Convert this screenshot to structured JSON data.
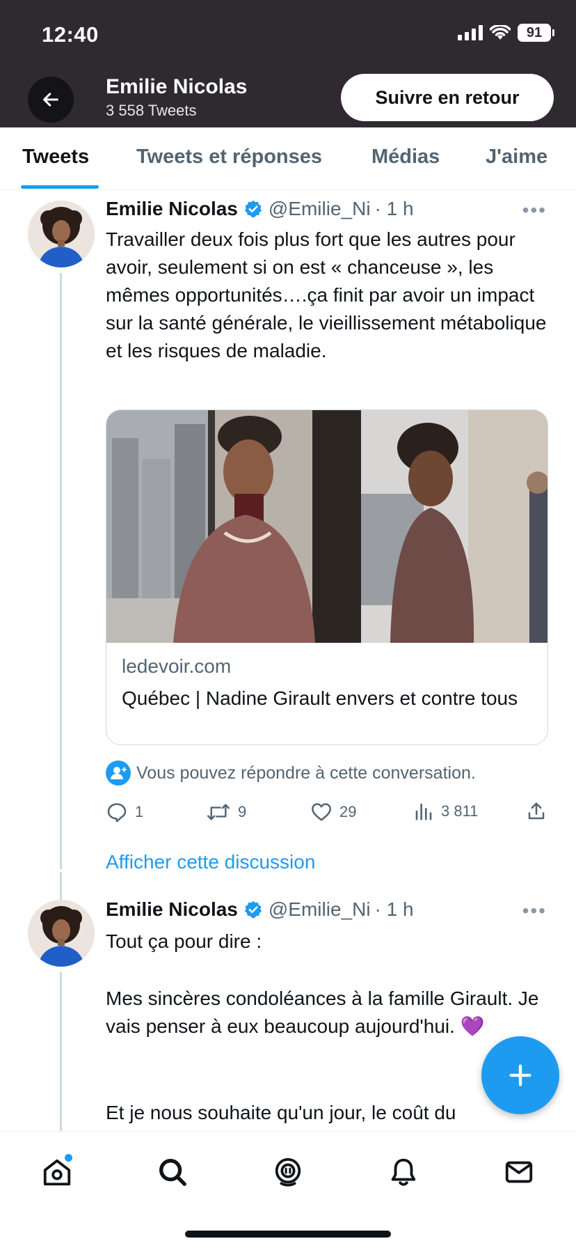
{
  "status_bar": {
    "time": "12:40",
    "battery": "91"
  },
  "profile": {
    "name": "Emilie Nicolas",
    "tweet_count": "3 558 Tweets",
    "follow_button": "Suivre en retour"
  },
  "tabs": [
    {
      "label": "Tweets",
      "active": true
    },
    {
      "label": "Tweets et réponses",
      "active": false
    },
    {
      "label": "Médias",
      "active": false
    },
    {
      "label": "J'aime",
      "active": false
    }
  ],
  "tweets": [
    {
      "name": "Emilie Nicolas",
      "handle": "@Emilie_Ni",
      "time": "· 1 h",
      "text": "Travailler deux fois plus fort que les autres pour avoir, seulement si on est « chanceuse », les mêmes opportunités….ça finit par avoir un impact sur la santé générale, le vieillissement métabolique et les risques de maladie.",
      "card": {
        "domain": "ledevoir.com",
        "title": "Québec | Nadine Girault envers et contre tous"
      },
      "reply_note": "Vous pouvez répondre à cette conversation.",
      "stats": {
        "replies": "1",
        "retweets": "9",
        "likes": "29",
        "views": "3 811"
      },
      "show_thread": "Afficher cette discussion"
    },
    {
      "name": "Emilie Nicolas",
      "handle": "@Emilie_Ni",
      "time": "· 1 h",
      "lines": [
        "Tout ça pour dire :",
        "Mes sincères condoléances à la famille Girault. Je vais penser à eux beaucoup aujourd'hui. 💜",
        "Et je nous souhaite qu'un jour, le coût du"
      ]
    }
  ],
  "icons": {
    "back": "arrow-left-icon",
    "verified": "verified-badge-icon",
    "more": "more-dots-icon",
    "reply": "reply-icon",
    "retweet": "retweet-icon",
    "like": "heart-icon",
    "views": "views-icon",
    "share": "share-icon",
    "compose": "plus-icon",
    "nav": [
      "home-icon",
      "search-icon",
      "spaces-icon",
      "bell-icon",
      "mail-icon"
    ]
  },
  "colors": {
    "accent": "#1d9bf0",
    "header_bg": "#2e2a30"
  }
}
